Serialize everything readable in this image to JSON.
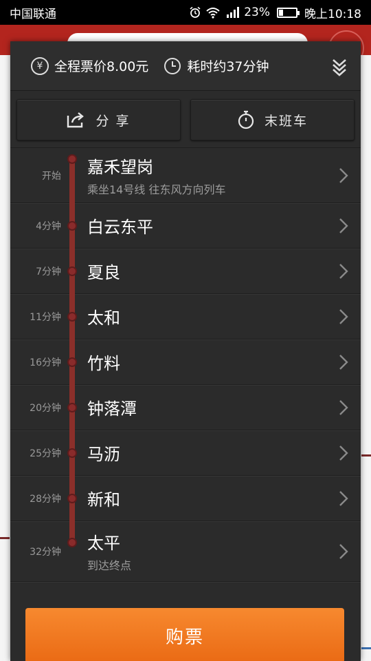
{
  "status_bar": {
    "carrier": "中国联通",
    "battery_percent": "23%",
    "battery_level": 0.23,
    "time": "晚上10:18"
  },
  "summary": {
    "fare": "全程票价8.00元",
    "duration": "耗时约37分钟"
  },
  "actions": {
    "share": "分 享",
    "last_train": "末班车"
  },
  "stations": [
    {
      "time": "开始",
      "name": "嘉禾望岗",
      "sub": "乘坐14号线 往东风方向列车"
    },
    {
      "time": "4分钟",
      "name": "白云东平",
      "sub": ""
    },
    {
      "time": "7分钟",
      "name": "夏良",
      "sub": ""
    },
    {
      "time": "11分钟",
      "name": "太和",
      "sub": ""
    },
    {
      "time": "16分钟",
      "name": "竹料",
      "sub": ""
    },
    {
      "time": "20分钟",
      "name": "钟落潭",
      "sub": ""
    },
    {
      "time": "25分钟",
      "name": "马沥",
      "sub": ""
    },
    {
      "time": "28分钟",
      "name": "新和",
      "sub": ""
    },
    {
      "time": "32分钟",
      "name": "太平",
      "sub": "到达终点"
    }
  ],
  "buy_button": "购票",
  "colors": {
    "route_line": "#8b2f2a",
    "buy_button": "#f07a22",
    "panel": "#2b2b2b"
  },
  "icons": {
    "fare": "yen-circle-icon",
    "duration": "clock-icon",
    "collapse": "double-chevron-down-icon",
    "share": "share-icon",
    "last_train": "stopwatch-icon",
    "row": "chevron-right-icon"
  }
}
